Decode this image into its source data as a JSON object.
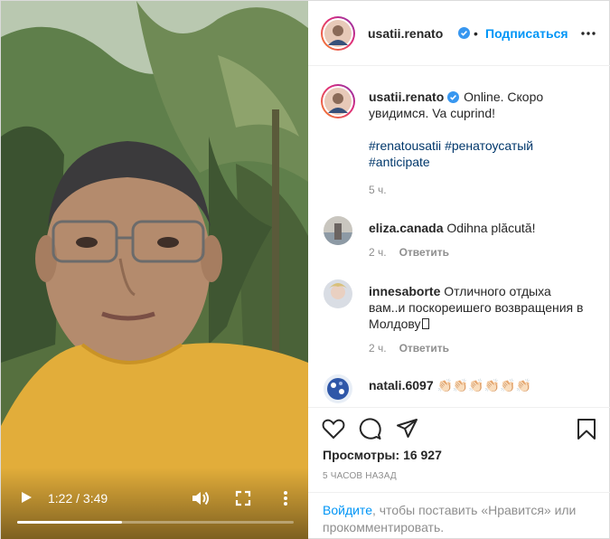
{
  "video": {
    "time": "1:22 / 3:49",
    "progress": 0.38,
    "play_icon": "play-icon",
    "volume_icon": "volume-icon",
    "fullscreen_icon": "fullscreen-icon",
    "more_icon": "more-vertical-icon"
  },
  "header": {
    "username": "usatii.renato",
    "separator": "•",
    "follow": "Подписаться"
  },
  "caption": {
    "username": "usatii.renato",
    "text_line1": " Online. Скоро",
    "text_line2": "увидимся. Va cuprind!",
    "hashtags_line1": [
      "#renatousatii",
      "#ренатоусатый"
    ],
    "hashtags_line2": [
      "#anticipate"
    ],
    "time": "5 ч."
  },
  "comments": [
    {
      "username": "eliza.canada",
      "text": " Odihna plăcută!",
      "time": "2 ч.",
      "reply": "Ответить"
    },
    {
      "username": "innesaborte",
      "text_line1": " Отличного отдыха",
      "text_line2": "вам..и поскореишего возвращения в",
      "text_line3": "Молдову",
      "time": "2 ч.",
      "reply": "Ответить"
    },
    {
      "username": "natali.6097",
      "text": " 👏🏻👏🏻👏🏻👏🏻👏🏻👏🏻"
    }
  ],
  "actions": {
    "views_label": "Просмотры: ",
    "views_count": "16 927",
    "ago": "5 часов назад"
  },
  "login": {
    "link": "Войдите",
    "text_line1": ", чтобы поставить «Нравится» или",
    "text_line2": "прокомментировать."
  },
  "colors": {
    "accent": "#0095f6",
    "hashtag": "#00376b",
    "muted": "#8e8e8e"
  }
}
